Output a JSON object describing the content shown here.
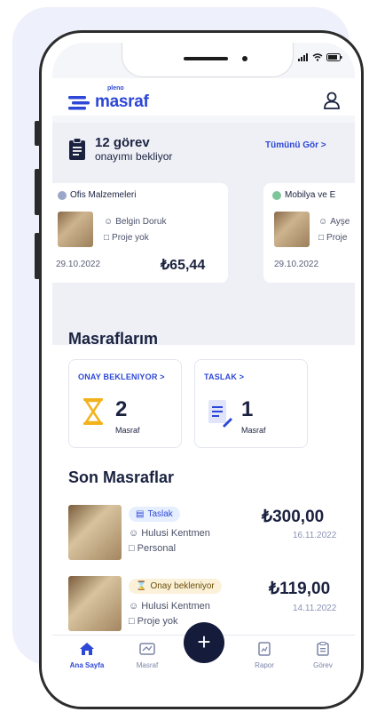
{
  "app": {
    "logo_small": "pleno",
    "logo_text": "masraf"
  },
  "approvals": {
    "count_text": "12 görev",
    "subtitle": "onayımı bekliyor",
    "see_all": "Tümünü Gör >",
    "cards": [
      {
        "category": "Ofis Malzemeleri",
        "user": "Belgin Doruk",
        "project": "Proje yok",
        "date": "29.10.2022",
        "amount": "₺65,44"
      },
      {
        "category": "Mobilya ve E",
        "user": "Ayşe",
        "project": "Proje",
        "date": "29.10.2022",
        "amount": ""
      }
    ]
  },
  "expenses": {
    "title": "Masraflarım",
    "pending": {
      "link": "ONAY BEKLENIYOR >",
      "count": "2",
      "unit": "Masraf"
    },
    "draft": {
      "link": "TASLAK >",
      "count": "1",
      "unit": "Masraf"
    }
  },
  "recent": {
    "title": "Son Masraflar",
    "items": [
      {
        "status": "Taslak",
        "user": "Hulusi Kentmen",
        "project": "Personal",
        "amount": "₺300,00",
        "date": "16.11.2022"
      },
      {
        "status": "Onay bekleniyor",
        "user": "Hulusi Kentmen",
        "project": "Proje yok",
        "amount": "₺119,00",
        "date": "14.11.2022"
      }
    ]
  },
  "tabs": [
    {
      "label": "Ana Sayfa"
    },
    {
      "label": "Masraf"
    },
    {
      "label": "Rapor"
    },
    {
      "label": "Görev"
    }
  ],
  "fab": "+",
  "colors": {
    "brand": "#2d47d6",
    "dark": "#141b3b",
    "draft_badge": "#e6efff",
    "pending_badge": "#fbf1d9"
  }
}
